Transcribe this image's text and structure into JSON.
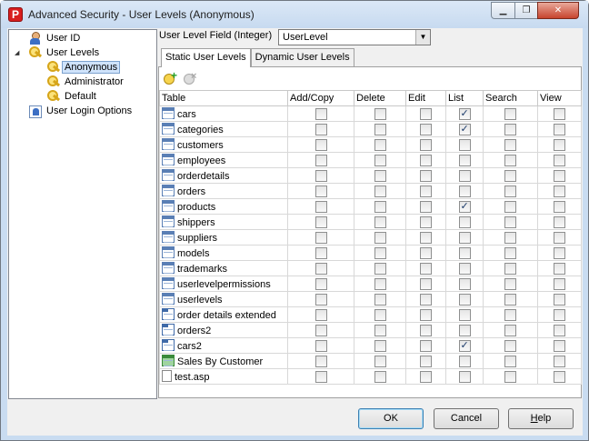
{
  "window": {
    "title": "Advanced Security - User Levels (Anonymous)",
    "min_glyph": "▁",
    "max_glyph": "❐",
    "close_glyph": "✕"
  },
  "tree": {
    "user_id": "User ID",
    "user_levels": "User Levels",
    "levels": [
      "Anonymous",
      "Administrator",
      "Default"
    ],
    "login_options": "User Login Options",
    "selected": "Anonymous"
  },
  "field": {
    "label": "User Level Field (Integer)",
    "value": "UserLevel"
  },
  "tabs": [
    "Static User Levels",
    "Dynamic User Levels"
  ],
  "active_tab": "Static User Levels",
  "columns": [
    "Table",
    "Add/Copy",
    "Delete",
    "Edit",
    "List",
    "Search",
    "View"
  ],
  "rows": [
    {
      "name": "cars",
      "icon": "table-icon",
      "perms": [
        false,
        false,
        false,
        true,
        false,
        false
      ]
    },
    {
      "name": "categories",
      "icon": "table-icon",
      "perms": [
        false,
        false,
        false,
        true,
        false,
        false
      ]
    },
    {
      "name": "customers",
      "icon": "table-icon",
      "perms": [
        false,
        false,
        false,
        false,
        false,
        false
      ]
    },
    {
      "name": "employees",
      "icon": "table-icon",
      "perms": [
        false,
        false,
        false,
        false,
        false,
        false
      ]
    },
    {
      "name": "orderdetails",
      "icon": "table-icon",
      "perms": [
        false,
        false,
        false,
        false,
        false,
        false
      ]
    },
    {
      "name": "orders",
      "icon": "table-icon",
      "perms": [
        false,
        false,
        false,
        false,
        false,
        false
      ]
    },
    {
      "name": "products",
      "icon": "table-icon",
      "perms": [
        false,
        false,
        false,
        true,
        false,
        false
      ]
    },
    {
      "name": "shippers",
      "icon": "table-icon",
      "perms": [
        false,
        false,
        false,
        false,
        false,
        false
      ]
    },
    {
      "name": "suppliers",
      "icon": "table-icon",
      "perms": [
        false,
        false,
        false,
        false,
        false,
        false
      ]
    },
    {
      "name": "models",
      "icon": "table-icon",
      "perms": [
        false,
        false,
        false,
        false,
        false,
        false
      ]
    },
    {
      "name": "trademarks",
      "icon": "table-icon",
      "perms": [
        false,
        false,
        false,
        false,
        false,
        false
      ]
    },
    {
      "name": "userlevelpermissions",
      "icon": "table-icon",
      "perms": [
        false,
        false,
        false,
        false,
        false,
        false
      ]
    },
    {
      "name": "userlevels",
      "icon": "table-icon",
      "perms": [
        false,
        false,
        false,
        false,
        false,
        false
      ]
    },
    {
      "name": "order details extended",
      "icon": "view-icon",
      "perms": [
        false,
        false,
        false,
        false,
        false,
        false
      ]
    },
    {
      "name": "orders2",
      "icon": "view-icon",
      "perms": [
        false,
        false,
        false,
        false,
        false,
        false
      ]
    },
    {
      "name": "cars2",
      "icon": "view-icon",
      "perms": [
        false,
        false,
        false,
        true,
        false,
        false
      ]
    },
    {
      "name": "Sales By Customer",
      "icon": "report-icon",
      "perms": [
        false,
        false,
        false,
        false,
        false,
        false
      ]
    },
    {
      "name": "test.asp",
      "icon": "file-icon",
      "perms": [
        false,
        false,
        false,
        false,
        false,
        false
      ]
    }
  ],
  "buttons": {
    "ok": "OK",
    "cancel": "Cancel",
    "help_pre": "",
    "help_ul": "H",
    "help_post": "elp"
  }
}
